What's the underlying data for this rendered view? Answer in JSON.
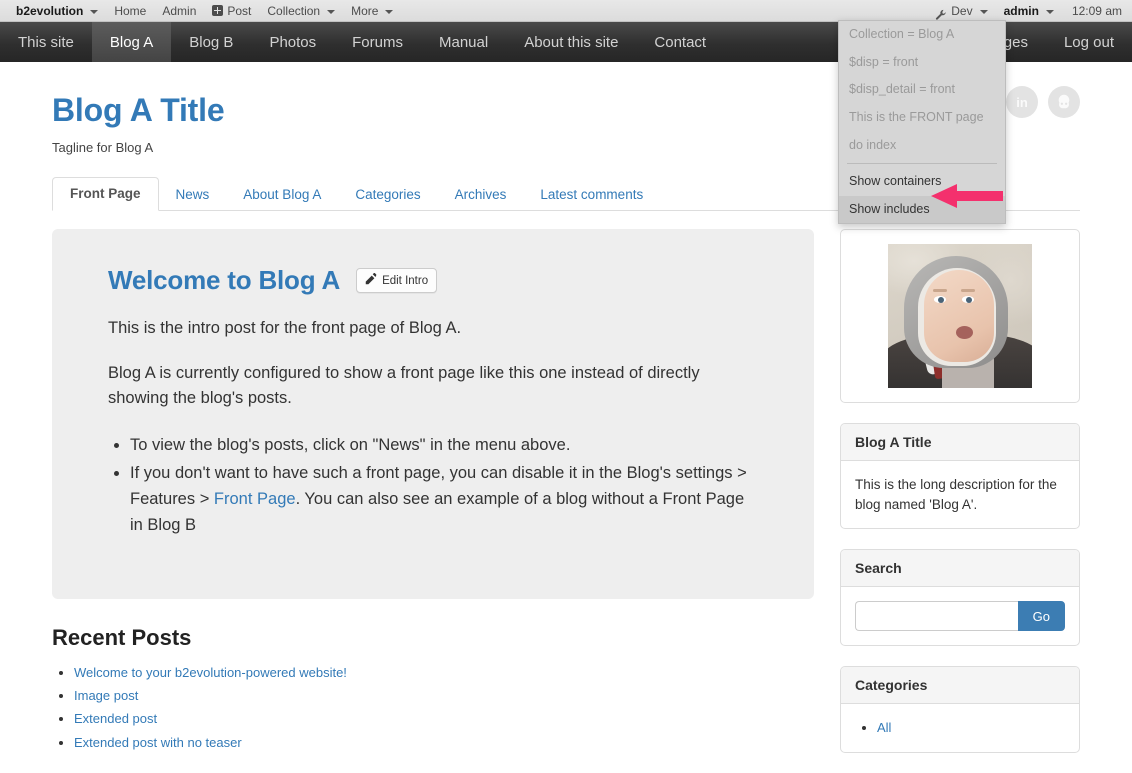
{
  "evobar": {
    "brand": "b2evolution",
    "left_items": [
      {
        "label": "Home",
        "icon": null,
        "caret": false
      },
      {
        "label": "Admin",
        "icon": null,
        "caret": false
      },
      {
        "label": "Post",
        "icon": "plus-box-icon",
        "caret": false
      },
      {
        "label": "Collection",
        "icon": null,
        "caret": true
      },
      {
        "label": "More",
        "icon": null,
        "caret": true
      }
    ],
    "right_items": [
      {
        "label": "Dev",
        "icon": "wrench-icon",
        "caret": true,
        "bold": false
      },
      {
        "label": "admin",
        "icon": null,
        "caret": true,
        "bold": true
      }
    ],
    "time": "12:09 am"
  },
  "sitenav": {
    "items": [
      {
        "label": "This site",
        "active": false
      },
      {
        "label": "Blog A",
        "active": true
      },
      {
        "label": "Blog B",
        "active": false
      },
      {
        "label": "Photos",
        "active": false
      },
      {
        "label": "Forums",
        "active": false
      },
      {
        "label": "Manual",
        "active": false
      },
      {
        "label": "About this site",
        "active": false
      },
      {
        "label": "Contact",
        "active": false
      }
    ],
    "right_items": [
      {
        "label": "Messages"
      },
      {
        "label": "Log out"
      }
    ]
  },
  "blog": {
    "title": "Blog A Title",
    "tagline": "Tagline for Blog A",
    "social": [
      {
        "name": "linkedin-icon",
        "glyph": "in"
      },
      {
        "name": "github-icon",
        "glyph": ""
      }
    ]
  },
  "tabs": [
    {
      "label": "Front Page",
      "active": true
    },
    {
      "label": "News",
      "active": false
    },
    {
      "label": "About Blog A",
      "active": false
    },
    {
      "label": "Categories",
      "active": false
    },
    {
      "label": "Archives",
      "active": false
    },
    {
      "label": "Latest comments",
      "active": false
    }
  ],
  "intro": {
    "title": "Welcome to Blog A",
    "edit_label": "Edit Intro",
    "paragraph": "This is the intro post for the front page of Blog A.",
    "paragraph2": "Blog A is currently configured to show a front page like this one instead of directly showing the blog's posts.",
    "bullet1": "To view the blog's posts, click on \"News\" in the menu above.",
    "bullet2_pre": "If you don't want to have such a front page, you can disable it in the Blog's settings > Features > ",
    "bullet2_link": "Front Page",
    "bullet2_post": ". You can also see an example of a blog without a Front Page in Blog B"
  },
  "recent": {
    "heading": "Recent Posts",
    "posts": [
      "Welcome to your b2evolution-powered website!",
      "Image post",
      "Extended post",
      "Extended post with no teaser"
    ]
  },
  "widgets": {
    "photo": {
      "alt": "baby-photo"
    },
    "description": {
      "title": "Blog A Title",
      "text": "This is the long description for the blog named 'Blog A'."
    },
    "search": {
      "title": "Search",
      "value": "",
      "placeholder": "",
      "go_label": "Go"
    },
    "categories": {
      "title": "Categories",
      "items": [
        "All"
      ]
    }
  },
  "dropdown": {
    "info_items": [
      "Collection = Blog A",
      "$disp = front",
      "$disp_detail = front",
      "This is the FRONT page",
      "do index"
    ],
    "actions": [
      {
        "label": "Show containers",
        "highlighted": false
      },
      {
        "label": "Show includes",
        "highlighted": true
      }
    ]
  },
  "annotation": {
    "arrow_color": "#f4306d",
    "points_to": "Show includes"
  }
}
